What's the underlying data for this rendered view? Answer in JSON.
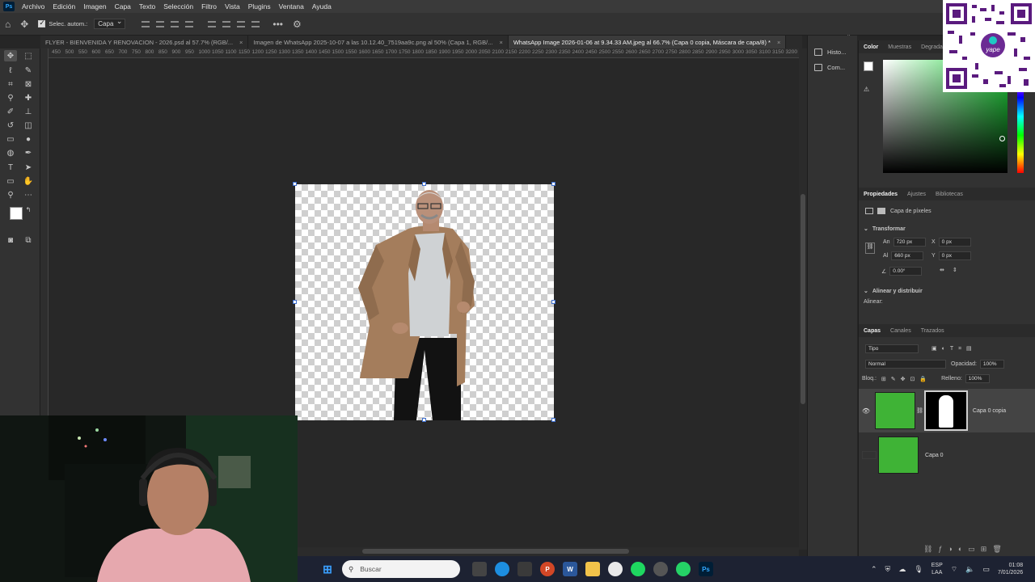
{
  "menubar": {
    "logo": "Ps",
    "items": [
      "Archivo",
      "Edición",
      "Imagen",
      "Capa",
      "Texto",
      "Selección",
      "Filtro",
      "Vista",
      "Plugins",
      "Ventana",
      "Ayuda"
    ]
  },
  "options": {
    "auto_select_label": "Selec. autom.:",
    "auto_select_value": "Capa"
  },
  "tabs": [
    {
      "label": "FLYER - BIENVENIDA Y RENOVACION - 2026.psd al 57.7% (RGB/...",
      "active": false
    },
    {
      "label": "Imagen de WhatsApp 2025-10-07 a las 10.12.40_7519aa9c.png al 50% (Capa 1, RGB/...",
      "active": false
    },
    {
      "label": "WhatsApp Image 2026-01-06 at 9.34.33 AM.jpeg al 66.7% (Capa 0 copia, Máscara de capa/8) *",
      "active": true
    }
  ],
  "ruler": [
    "450",
    "500",
    "550",
    "600",
    "650",
    "700",
    "750",
    "800",
    "850",
    "900",
    "950",
    "1000",
    "1050",
    "1100",
    "1150",
    "1200",
    "1250",
    "1300",
    "1350",
    "1400",
    "1450",
    "1500",
    "1550",
    "1600",
    "1650",
    "1700",
    "1750",
    "1800",
    "1850",
    "1900",
    "1950",
    "2000",
    "2050",
    "2100",
    "2150",
    "2200",
    "2250",
    "2300",
    "2350",
    "2400",
    "2450",
    "2500",
    "2550",
    "2600",
    "2650",
    "2700",
    "2750",
    "2800",
    "2850",
    "2900",
    "2950",
    "3000",
    "3050",
    "3100",
    "3150",
    "3200",
    "3250",
    "3300"
  ],
  "sidestrip": {
    "history": "Histo...",
    "comments": "Com..."
  },
  "color_panel": {
    "tabs": [
      "Color",
      "Muestras",
      "Degradados"
    ]
  },
  "properties": {
    "tabs": [
      "Propiedades",
      "Ajustes",
      "Bibliotecas"
    ],
    "layer_type": "Capa de píxeles",
    "transform_title": "Transformar",
    "w_label": "An",
    "w_value": "720 px",
    "h_label": "Al",
    "h_value": "660 px",
    "x_label": "X",
    "x_value": "0 px",
    "y_label": "Y",
    "y_value": "0 px",
    "angle_value": "0.00°",
    "align_title": "Alinear y distribuir",
    "align_label": "Alinear:"
  },
  "layers_panel": {
    "tabs": [
      "Capas",
      "Canales",
      "Trazados"
    ],
    "filter_label": "Tipo",
    "blend_mode": "Normal",
    "opacity_label": "Opacidad:",
    "opacity_value": "100%",
    "lock_label": "Bloq.:",
    "fill_label": "Relleno:",
    "fill_value": "100%",
    "layers": [
      {
        "name": "Capa 0 copia",
        "visible": true,
        "has_mask": true
      },
      {
        "name": "Capa 0",
        "visible": false,
        "has_mask": false
      }
    ]
  },
  "qr": {
    "brand": "yape"
  },
  "taskbar": {
    "search_placeholder": "Buscar",
    "lang_top": "ESP",
    "lang_bottom": "LAA",
    "time": "01:08",
    "date": "7/01/2026",
    "ps_label": "Ps"
  }
}
